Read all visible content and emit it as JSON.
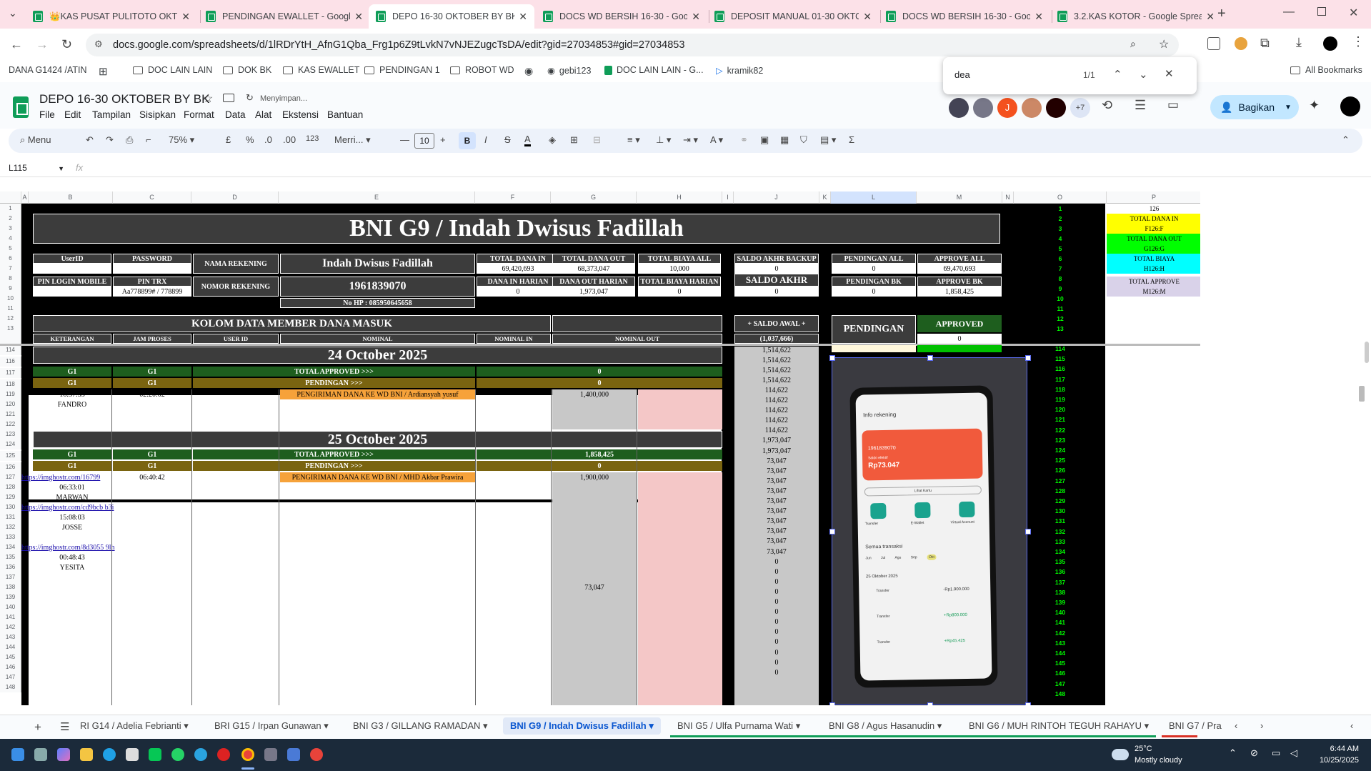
{
  "browser": {
    "tabs": [
      {
        "label": "👑KAS PUSAT PULITOTO OKTOB"
      },
      {
        "label": "PENDINGAN EWALLET - Google"
      },
      {
        "label": "DEPO 16-30 OKTOBER BY BK - G"
      },
      {
        "label": "DOCS WD BERSIH 16-30 - Goo"
      },
      {
        "label": "DEPOSIT MANUAL 01-30 OKTO"
      },
      {
        "label": "DOCS WD BERSIH 16-30 - Goo"
      },
      {
        "label": "3.2.KAS KOTOR - Google Sprea"
      }
    ],
    "url": "docs.google.com/spreadsheets/d/1lRDrYtH_AfnG1Qba_Frg1p6Z9tLvkN7vNJEZugcTsDA/edit?gid=27034853#gid=27034853",
    "profile_label": "DANA G1424 /ATIN",
    "bookmarks": [
      "DOC LAIN LAIN",
      "DOK BK",
      "KAS EWALLET",
      "PENDINGAN 1",
      "ROBOT WD",
      "gebi123",
      "DOC LAIN LAIN - G...",
      "kramik82"
    ],
    "all_bookmarks": "All Bookmarks",
    "find": {
      "query": "dea",
      "count": "1/1"
    }
  },
  "doc": {
    "title": "DEPO 16-30 OKTOBER BY BK",
    "saving": "Menyimpan...",
    "menus": [
      "File",
      "Edit",
      "Tampilan",
      "Sisipkan",
      "Format",
      "Data",
      "Alat",
      "Ekstensi",
      "Bantuan"
    ],
    "share": "Bagikan",
    "collab_more": "+7",
    "collab_j": "J"
  },
  "toolbar": {
    "menu": "Menu",
    "zoom": "75%",
    "currency": "£",
    "percent": "%",
    "dec_less": ".0",
    "dec_more": ".00",
    "num": "123",
    "font": "Merri...",
    "size": "10",
    "bold": "B",
    "italic": "I",
    "strike": "S",
    "color": "A"
  },
  "formula": {
    "cellref": "L115",
    "fx": "fx"
  },
  "columns": [
    "A",
    "B",
    "C",
    "D",
    "E",
    "F",
    "G",
    "H",
    "I",
    "J",
    "K",
    "L",
    "M",
    "N",
    "O",
    "P"
  ],
  "sheet": {
    "title": "BNI G9 / Indah Dwisus Fadillah",
    "userid_h": "UserID",
    "password_h": "PASSWORD",
    "nama_rek_h": "NAMA REKENING",
    "nama_rek": "Indah Dwisus Fadillah",
    "pin_login_h": "PIN LOGIN MOBILE",
    "pin_trx_h": "PIN TRX",
    "pin_trx": "Aa778899# / 778899",
    "nomor_rek_h": "NOMOR REKENING",
    "nomor_rek": "1961839070",
    "nohp": "No HP : 085950645658",
    "total_in_h": "TOTAL DANA IN",
    "total_in": "69,420,693",
    "total_out_h": "TOTAL DANA OUT",
    "total_out": "68,373,047",
    "total_biaya_h": "TOTAL BIAYA ALL",
    "total_biaya": "10,000",
    "in_harian_h": "DANA IN HARIAN",
    "in_harian": "0",
    "out_harian_h": "DANA OUT HARIAN",
    "out_harian": "1,973,047",
    "biaya_harian_h": "TOTAL BIAYA HARIAN",
    "biaya_harian": "0",
    "saldo_backup_h": "SALDO AKHR BACKUP",
    "saldo_backup": "0",
    "saldo_akhr_h": "SALDO AKHR",
    "saldo_akhr": "0",
    "pend_all_h": "PENDINGAN ALL",
    "pend_all": "0",
    "approve_all_h": "APPROVE ALL",
    "approve_all": "69,470,693",
    "pend_bk_h": "PENDINGAN BK",
    "pend_bk": "0",
    "approve_bk_h": "APPROVE BK",
    "approve_bk": "1,858,425",
    "kolom_title": "KOLOM DATA MEMBER DANA MASUK",
    "saldo_awal_h": "+ SALDO AWAL +",
    "saldo_awal": "(1,037,666)",
    "pendingan": "PENDINGAN",
    "approved": "APPROVED",
    "approved_val": "0",
    "col_ket": "KETERANGAN",
    "col_jam": "JAM PROSES",
    "col_uid": "USER ID",
    "col_nominal": "NOMINAL",
    "col_nin": "NOMINAL IN",
    "col_nout": "NOMINAL OUT",
    "date1": "24 October 2025",
    "date2": "25 October 2025",
    "g1": "G1",
    "total_approved": "TOTAL APPROVED >>>",
    "pendingan_row": "PENDINGAN >>>",
    "ta1": "0",
    "pd1": "0",
    "ta2": "1,858,425",
    "pd2": "0",
    "r118_time": "16:37:33",
    "r118_jam": "02:20:02",
    "r118_desc": "PENGIRIMAN DANA KE WD BNI  / Ardiansyah yusuf",
    "r118_out": "1,400,000",
    "r119_name": "FANDRO",
    "r126_link": "https://imghostr.com/16799",
    "r126_jam": "06:40:42",
    "r126_desc": "PENGIRIMAN DANA KE WD BNI  / MHD Akbar Prawira",
    "r126_out": "1,900,000",
    "r127": "06:33:01",
    "r128": "MARWAN",
    "r129_link": "https://imghostr.com/cd9bcb b3i",
    "r130": "15:08:03",
    "r131": "JOSSE",
    "r133_link": "https://imghostr.com/8d3055 9lh",
    "r134": "00:48:43",
    "r135": "YESITA",
    "r137_g": "73,047",
    "saldo_col": [
      "1,514,622",
      "1,514,622",
      "1,514,622",
      "1,514,622",
      "114,622",
      "114,622",
      "114,622",
      "114,622",
      "114,622",
      "1,973,047",
      "1,973,047",
      "73,047",
      "73,047",
      "73,047",
      "73,047",
      "73,047",
      "73,047",
      "73,047",
      "73,047",
      "73,047",
      "73,047",
      "0",
      "0",
      "0",
      "0",
      "0",
      "0",
      "0",
      "0",
      "0",
      "0",
      "0",
      "0"
    ],
    "p_col": [
      {
        "r": "1",
        "t": "126",
        "c": ""
      },
      {
        "r": "2",
        "t": "TOTAL DANA IN",
        "c": "#ffff00"
      },
      {
        "r": "3",
        "t": "F126:F",
        "c": "#ffff00"
      },
      {
        "r": "4",
        "t": "TOTAL DANA OUT",
        "c": "#00ff00"
      },
      {
        "r": "5",
        "t": "G126:G",
        "c": "#00ff00"
      },
      {
        "r": "6",
        "t": "TOTAL BIAYA",
        "c": "#00ffff"
      },
      {
        "r": "7",
        "t": "H126:H",
        "c": "#00ffff"
      },
      {
        "r": "8",
        "t": "TOTAL APPROVE",
        "c": "#d9d2e9"
      },
      {
        "r": "9",
        "t": "M126:M",
        "c": "#d9d2e9"
      }
    ],
    "o_nums": [
      "1",
      "2",
      "3",
      "4",
      "5",
      "6",
      "7",
      "8",
      "9",
      "10",
      "11",
      "12",
      "13",
      "114",
      "115",
      "116",
      "117",
      "118",
      "119",
      "120",
      "121",
      "122",
      "123",
      "124",
      "125",
      "126",
      "127",
      "128",
      "129",
      "130",
      "131",
      "132",
      "133",
      "134",
      "135",
      "136",
      "137",
      "138",
      "139",
      "140",
      "141",
      "142",
      "143",
      "144",
      "145",
      "146",
      "147",
      "148"
    ],
    "row_nums": [
      "1",
      "2",
      "3",
      "4",
      "5",
      "6",
      "7",
      "8",
      "9",
      "10",
      "11",
      "12",
      "13",
      "114",
      "116",
      "117",
      "118",
      "119",
      "120",
      "121",
      "122",
      "123",
      "124",
      "125",
      "126",
      "127",
      "128",
      "129",
      "130",
      "131",
      "132",
      "133",
      "134",
      "135",
      "136",
      "137",
      "138",
      "139",
      "140",
      "141",
      "142",
      "143",
      "144",
      "145",
      "146",
      "147",
      "148"
    ]
  },
  "phone": {
    "title": "Info rekening",
    "acct": "1961839070",
    "balance_label": "Saldo efektif",
    "balance": "Rp73.047",
    "detail": "Lihat Kartu",
    "actions": [
      "Transfer",
      "E-Wallet",
      "Virtual Account"
    ],
    "section": "Semua transaksi",
    "months": [
      "Jun",
      "Jul",
      "Agu",
      "Sep",
      "Okt"
    ],
    "date": "25 Oktober 2025",
    "tx": [
      {
        "label": "Transfer",
        "amt": "-Rp1.900.000"
      },
      {
        "label": "Transfer",
        "amt": "+Rp800.000"
      },
      {
        "label": "Transfer",
        "amt": "+Rp45.425"
      }
    ]
  },
  "sheettabs": [
    "RI G14 / Adelia Febrianti",
    "BRI G15 / Irpan Gunawan",
    "BNI G3 / GILLANG RAMADAN",
    "BNI G9 / Indah Dwisus Fadillah",
    "BNI G5 / Ulfa Purnama Wati",
    "BNI G8 / Agus Hasanudin",
    "BNI G6 / MUH RINTOH TEGUH RAHAYU",
    "BNI G7 / Pra"
  ],
  "taskbar": {
    "temp": "25°C",
    "weather": "Mostly cloudy",
    "time": "6:44 AM",
    "date": "10/25/2025"
  }
}
